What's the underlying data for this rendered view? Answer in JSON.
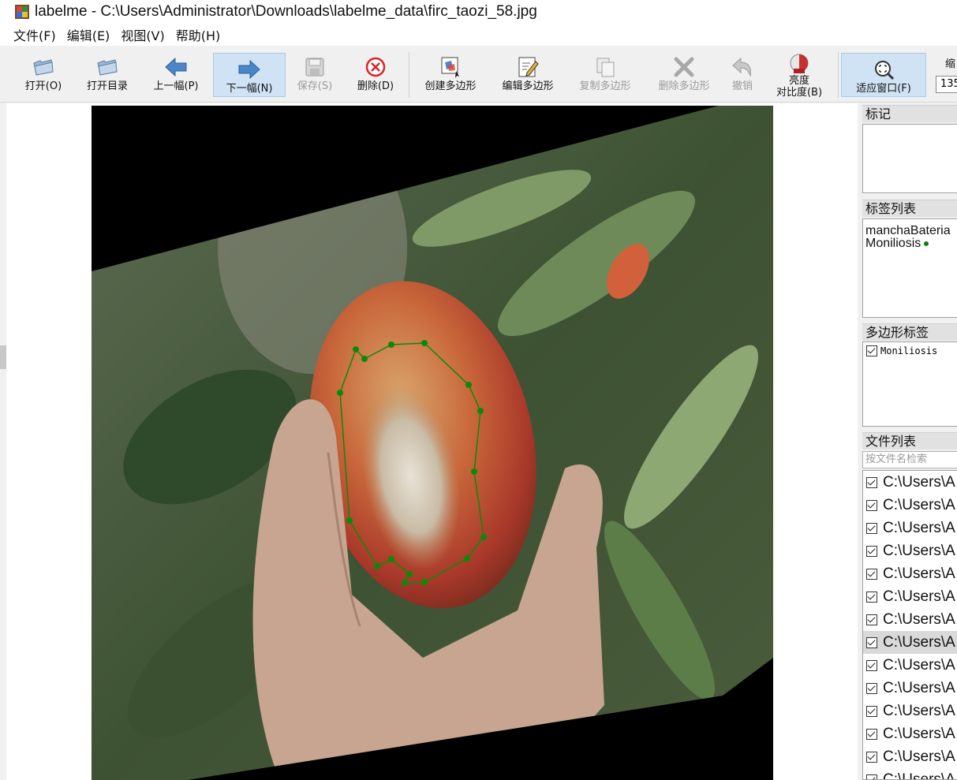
{
  "window": {
    "title": "labelme - C:\\Users\\Administrator\\Downloads\\labelme_data\\firc_taozi_58.jpg"
  },
  "menu": [
    "文件(F)",
    "编辑(E)",
    "视图(V)",
    "帮助(H)"
  ],
  "toolbar": {
    "open": "打开(O)",
    "open_dir": "打开目录",
    "prev": "上一幅(P)",
    "next": "下一幅(N)",
    "save": "保存(S)",
    "delete": "删除(D)",
    "create_polygon": "创建多边形",
    "edit_polygon": "编辑多边形",
    "copy_polygon": "复制多边形",
    "delete_polygon": "删除多边形",
    "undo": "撤销",
    "brightness_line1": "亮度",
    "brightness_line2": "对比度(B)",
    "fit_window": "适应窗口(F)",
    "zoom_label": "缩",
    "zoom_value": "135"
  },
  "docks": {
    "flags_title": "标记",
    "labels_title": "标签列表",
    "labels": [
      "manchaBateria",
      "Moniliosis"
    ],
    "polygons_title": "多边形标签",
    "polygons": [
      {
        "label": "Moniliosis",
        "checked": true
      }
    ],
    "files_title": "文件列表",
    "search_placeholder": "按文件名检索",
    "files": [
      "C:\\Users\\A",
      "C:\\Users\\A",
      "C:\\Users\\A",
      "C:\\Users\\A",
      "C:\\Users\\A",
      "C:\\Users\\A",
      "C:\\Users\\A",
      "C:\\Users\\A",
      "C:\\Users\\A",
      "C:\\Users\\A",
      "C:\\Users\\A",
      "C:\\Users\\A",
      "C:\\Users\\A",
      "C:\\Users\\A"
    ],
    "selected_file_index": 7
  },
  "colors": {
    "polygon": "#0a8a0a",
    "toolbar_active": "#cfe3f5"
  }
}
